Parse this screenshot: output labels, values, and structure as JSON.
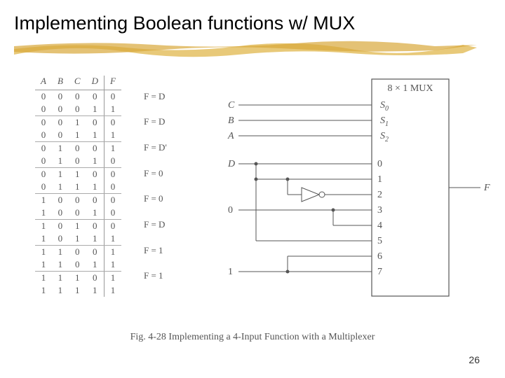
{
  "title": "Implementing Boolean functions w/ MUX",
  "page_number": "26",
  "caption": "Fig. 4-28   Implementing a 4-Input Function with a Multiplexer",
  "table": {
    "headers": [
      "A",
      "B",
      "C",
      "D",
      "F"
    ],
    "rows": [
      [
        "0",
        "0",
        "0",
        "0",
        "0"
      ],
      [
        "0",
        "0",
        "0",
        "1",
        "1"
      ],
      [
        "0",
        "0",
        "1",
        "0",
        "0"
      ],
      [
        "0",
        "0",
        "1",
        "1",
        "1"
      ],
      [
        "0",
        "1",
        "0",
        "0",
        "1"
      ],
      [
        "0",
        "1",
        "0",
        "1",
        "0"
      ],
      [
        "0",
        "1",
        "1",
        "0",
        "0"
      ],
      [
        "0",
        "1",
        "1",
        "1",
        "0"
      ],
      [
        "1",
        "0",
        "0",
        "0",
        "0"
      ],
      [
        "1",
        "0",
        "0",
        "1",
        "0"
      ],
      [
        "1",
        "0",
        "1",
        "0",
        "0"
      ],
      [
        "1",
        "0",
        "1",
        "1",
        "1"
      ],
      [
        "1",
        "1",
        "0",
        "0",
        "1"
      ],
      [
        "1",
        "1",
        "0",
        "1",
        "1"
      ],
      [
        "1",
        "1",
        "1",
        "0",
        "1"
      ],
      [
        "1",
        "1",
        "1",
        "1",
        "1"
      ]
    ],
    "annotations": [
      "F = D",
      "F = D",
      "F = D'",
      "F = 0",
      "F = 0",
      "F = D",
      "F = 1",
      "F = 1"
    ]
  },
  "mux": {
    "title": "8 × 1 MUX",
    "selects": [
      "S",
      "S",
      "S"
    ],
    "select_subs": [
      "0",
      "1",
      "2"
    ],
    "select_inputs": [
      "C",
      "B",
      "A"
    ],
    "data_labels": [
      "0",
      "1",
      "2",
      "3",
      "4",
      "5",
      "6",
      "7"
    ],
    "left_labels": {
      "D": "D",
      "zero": "0",
      "one": "1"
    },
    "output": "F"
  }
}
